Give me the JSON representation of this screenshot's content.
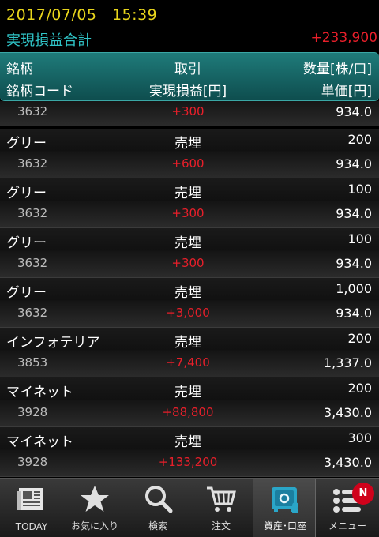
{
  "status": {
    "datetime": "2017/07/05　15:39"
  },
  "summary": {
    "label": "実現損益合計",
    "value": "+233,900"
  },
  "header": {
    "col1_top": "銘柄",
    "col2_top": "取引",
    "col3_top": "数量[株/口]",
    "col1_bottom": "銘柄コード",
    "col2_bottom": "実現損益[円]",
    "col3_bottom": "単価[円]"
  },
  "rows": [
    {
      "name": "",
      "side": "",
      "qty": "",
      "code": "3632",
      "pl": "+300",
      "price": "934.0"
    },
    {
      "name": "グリー",
      "side": "売埋",
      "qty": "200",
      "code": "3632",
      "pl": "+600",
      "price": "934.0"
    },
    {
      "name": "グリー",
      "side": "売埋",
      "qty": "100",
      "code": "3632",
      "pl": "+300",
      "price": "934.0"
    },
    {
      "name": "グリー",
      "side": "売埋",
      "qty": "100",
      "code": "3632",
      "pl": "+300",
      "price": "934.0"
    },
    {
      "name": "グリー",
      "side": "売埋",
      "qty": "1,000",
      "code": "3632",
      "pl": "+3,000",
      "price": "934.0"
    },
    {
      "name": "インフォテリア",
      "side": "売埋",
      "qty": "200",
      "code": "3853",
      "pl": "+7,400",
      "price": "1,337.0"
    },
    {
      "name": "マイネット",
      "side": "売埋",
      "qty": "200",
      "code": "3928",
      "pl": "+88,800",
      "price": "3,430.0"
    },
    {
      "name": "マイネット",
      "side": "売埋",
      "qty": "300",
      "code": "3928",
      "pl": "+133,200",
      "price": "3,430.0"
    }
  ],
  "tabs": [
    {
      "label": "TODAY",
      "icon": "newspaper-icon"
    },
    {
      "label": "お気に入り",
      "icon": "star-icon"
    },
    {
      "label": "検索",
      "icon": "search-icon"
    },
    {
      "label": "注文",
      "icon": "cart-icon"
    },
    {
      "label": "資産･口座",
      "icon": "safe-icon",
      "active": true
    },
    {
      "label": "メニュー",
      "icon": "menu-icon",
      "badge": "N"
    }
  ],
  "colors": {
    "accent": "#30c6c9",
    "profit": "#e81f2a",
    "datetime": "#e8d51c",
    "header": "#1f7b7a"
  }
}
